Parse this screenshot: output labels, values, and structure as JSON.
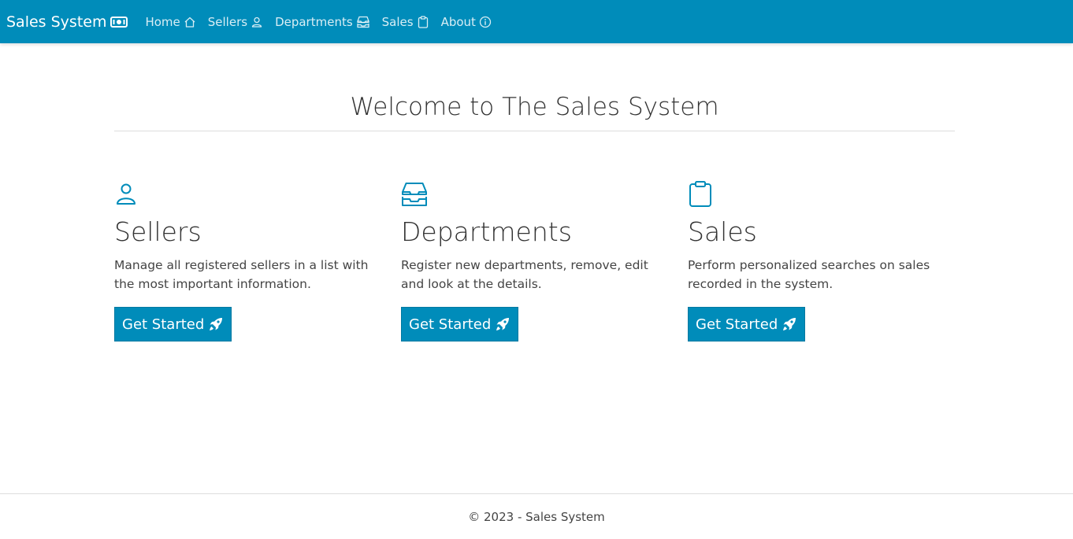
{
  "app": {
    "brand": "Sales System",
    "brand_icon": "cash-icon",
    "accent_color": "#008cba"
  },
  "nav": {
    "items": [
      {
        "label": "Home",
        "icon": "house-icon"
      },
      {
        "label": "Sellers",
        "icon": "person-icon"
      },
      {
        "label": "Departments",
        "icon": "inboxes-icon"
      },
      {
        "label": "Sales",
        "icon": "clipboard-icon"
      },
      {
        "label": "About",
        "icon": "info-circle-icon"
      }
    ]
  },
  "main": {
    "title": "Welcome to The Sales System",
    "cards": [
      {
        "title": "Sellers",
        "icon": "person-icon",
        "description": "Manage all registered sellers in a list with the most important information.",
        "button_label": "Get Started",
        "button_icon": "rocket-icon"
      },
      {
        "title": "Departments",
        "icon": "inboxes-icon",
        "description": "Register new departments, remove, edit and look at the details.",
        "button_label": "Get Started",
        "button_icon": "rocket-icon"
      },
      {
        "title": "Sales",
        "icon": "clipboard-icon",
        "description": "Perform personalized searches on sales recorded in the system.",
        "button_label": "Get Started",
        "button_icon": "rocket-icon"
      }
    ]
  },
  "footer": {
    "text": "© 2023 - Sales System"
  }
}
